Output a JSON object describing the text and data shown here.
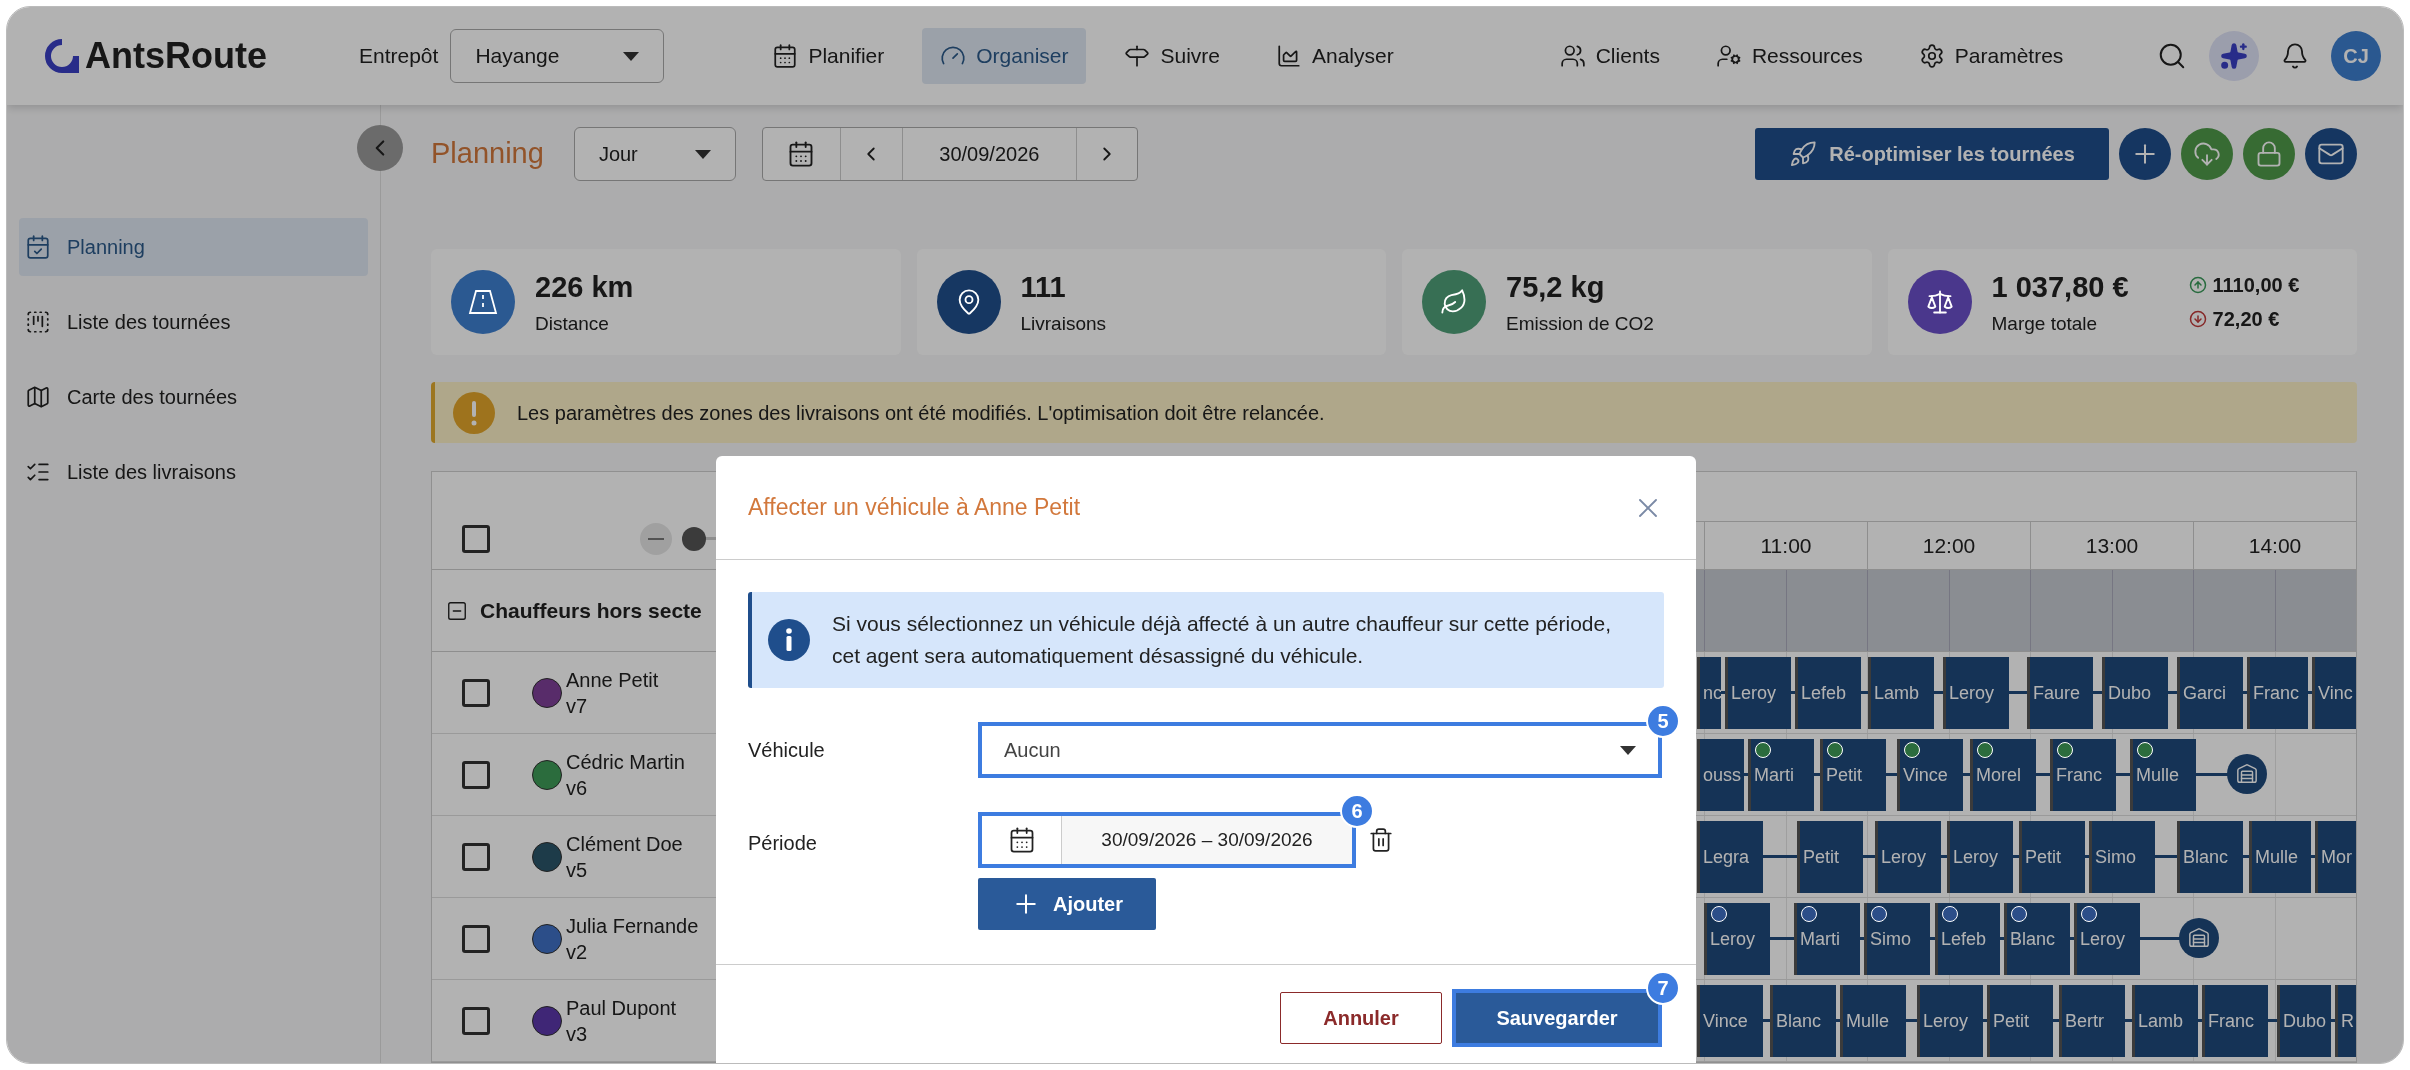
{
  "brand": "AntsRoute",
  "warehouse": {
    "label": "Entrepôt",
    "value": "Hayange"
  },
  "nav": [
    {
      "label": "Planifier",
      "selected": false
    },
    {
      "label": "Organiser",
      "selected": true
    },
    {
      "label": "Suivre",
      "selected": false
    },
    {
      "label": "Analyser",
      "selected": false
    },
    {
      "label": "Clients",
      "selected": false
    },
    {
      "label": "Ressources",
      "selected": false
    },
    {
      "label": "Paramètres",
      "selected": false
    }
  ],
  "user": {
    "initials": "CJ"
  },
  "sidebar": {
    "items": [
      {
        "label": "Planning",
        "selected": true
      },
      {
        "label": "Liste des tournées",
        "selected": false
      },
      {
        "label": "Carte des tournées",
        "selected": false
      },
      {
        "label": "Liste des livraisons",
        "selected": false
      }
    ]
  },
  "toolbar": {
    "title": "Planning",
    "view": "Jour",
    "date": "30/09/2026",
    "optimize_button": "Ré-optimiser les tournées"
  },
  "stats": [
    {
      "value": "226 km",
      "label": "Distance",
      "color": "#2b5991"
    },
    {
      "value": "111",
      "label": "Livraisons",
      "color": "#163762"
    },
    {
      "value": "75,2 kg",
      "label": "Emission de CO2",
      "color": "#376f54"
    },
    {
      "value": "1 037,80 €",
      "label": "Marge totale",
      "color": "#4a378c",
      "up": "1110,00 €",
      "down": "72,20 €"
    }
  ],
  "alert": {
    "text": "Les paramètres des zones des livraisons ont été modifiés. L'optimisation doit être relancée."
  },
  "planning": {
    "select_all_checked": false,
    "zoom": {
      "level": 0
    },
    "group": "Chauffeurs hors secte",
    "group_expanded": true,
    "hours": [
      "11:00",
      "12:00",
      "13:00",
      "14:00"
    ],
    "drivers": [
      {
        "name": "Anne Petit",
        "vehicle": "v7",
        "color": "#582c6a",
        "checked": false,
        "stops": [
          {
            "label": "nc",
            "dot": false
          },
          {
            "label": "Leroy",
            "dot": false
          },
          {
            "label": "Lefeb",
            "dot": false
          },
          {
            "label": "Lamb",
            "dot": false
          },
          {
            "label": "Leroy",
            "dot": false
          },
          {
            "label": "Faure",
            "dot": false
          },
          {
            "label": "Dubo",
            "dot": false
          },
          {
            "label": "Garci",
            "dot": false
          },
          {
            "label": "Franc",
            "dot": false
          },
          {
            "label": "Vinc",
            "dot": false
          }
        ]
      },
      {
        "name": "Cédric Martin",
        "vehicle": "v6",
        "color": "#2b6c3d",
        "checked": false,
        "stops": [
          {
            "label": "ouss",
            "dot": false
          },
          {
            "label": "Marti",
            "dot": true
          },
          {
            "label": "Petit",
            "dot": true
          },
          {
            "label": "Vince",
            "dot": true
          },
          {
            "label": "Morel",
            "dot": true
          },
          {
            "label": "Franc",
            "dot": true
          },
          {
            "label": "Mulle",
            "dot": true
          },
          {
            "kind": "depot"
          }
        ]
      },
      {
        "name": "Clément Doe",
        "vehicle": "v5",
        "color": "#1d3b49",
        "checked": false,
        "stops": [
          {
            "label": "Legra",
            "dot": false
          },
          {
            "label": "Petit",
            "dot": false
          },
          {
            "label": "Leroy",
            "dot": false
          },
          {
            "label": "Leroy",
            "dot": false
          },
          {
            "label": "Petit",
            "dot": false
          },
          {
            "label": "Simo",
            "dot": false
          },
          {
            "label": "Blanc",
            "dot": false
          },
          {
            "label": "Mulle",
            "dot": false
          },
          {
            "label": "Mor",
            "dot": false
          }
        ]
      },
      {
        "name": "Julia Fernande",
        "vehicle": "v2",
        "color": "#2c4e89",
        "checked": false,
        "stops": [
          {
            "label": "Leroy",
            "dot": true
          },
          {
            "label": "Marti",
            "dot": true
          },
          {
            "label": "Simo",
            "dot": true
          },
          {
            "label": "Lefeb",
            "dot": true
          },
          {
            "label": "Blanc",
            "dot": true
          },
          {
            "label": "Leroy",
            "dot": true
          },
          {
            "kind": "depot"
          }
        ]
      },
      {
        "name": "Paul Dupont",
        "vehicle": "v3",
        "color": "#3f2676",
        "checked": false,
        "stops": [
          {
            "label": "Vince",
            "dot": false
          },
          {
            "label": "Blanc",
            "dot": false
          },
          {
            "label": "Mulle",
            "dot": false
          },
          {
            "label": "Leroy",
            "dot": false
          },
          {
            "label": "Petit",
            "dot": false
          },
          {
            "label": "Bertr",
            "dot": false
          },
          {
            "label": "Lamb",
            "dot": false
          },
          {
            "label": "Franc",
            "dot": false
          },
          {
            "label": "Dubo",
            "dot": false
          },
          {
            "label": "R",
            "dot": false
          }
        ]
      }
    ]
  },
  "dialog": {
    "title": "Affecter un véhicule à Anne Petit",
    "info": "Si vous sélectionnez un véhicule déjà affecté à un autre chauffeur sur cette période, cet agent sera automatiquement désassigné du véhicule.",
    "vehicle": {
      "label": "Véhicule",
      "value": "Aucun",
      "highlighted": true,
      "badge": "5"
    },
    "period": {
      "label": "Période",
      "value": "30/09/2026 – 30/09/2026",
      "highlighted": true,
      "badge": "6"
    },
    "add_button": "Ajouter",
    "cancel_button": {
      "label": "Annuler",
      "highlighted": false
    },
    "save_button": {
      "label": "Sauvegarder",
      "highlighted": true,
      "badge": "7"
    }
  }
}
